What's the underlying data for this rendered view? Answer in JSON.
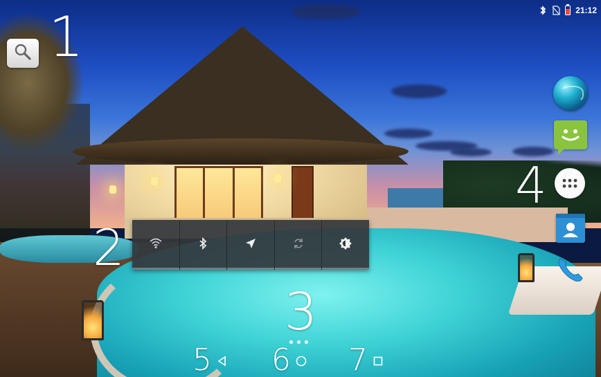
{
  "status_bar": {
    "time": "21:12",
    "icons": [
      "bluetooth-icon",
      "no-sim-icon",
      "battery-icon"
    ],
    "battery_color": "#e84a3a"
  },
  "search": {
    "icon": "search-icon"
  },
  "callouts": [
    "1",
    "2",
    "3",
    "4",
    "5",
    "6",
    "7"
  ],
  "quick_settings": {
    "tiles": [
      "wifi-icon",
      "bluetooth-icon",
      "location-icon",
      "auto-rotate-icon",
      "brightness-icon"
    ],
    "panel_color": "#34383c"
  },
  "dock": {
    "icons": [
      "browser-globe-icon",
      "messaging-icon",
      "app-drawer-icon",
      "contacts-icon",
      "phone-icon"
    ]
  },
  "nav_bar": {
    "buttons": [
      "back-icon",
      "home-icon",
      "recents-icon"
    ],
    "page_indicator_dots": 3
  }
}
